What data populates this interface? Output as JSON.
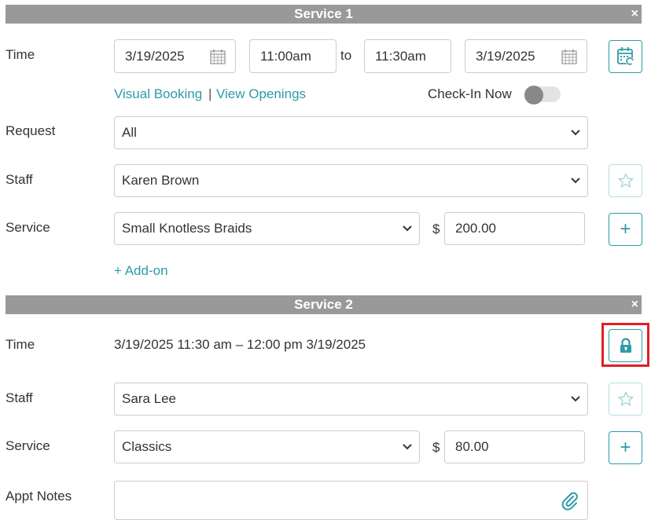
{
  "service1": {
    "header": "Service 1",
    "close_glyph": "×",
    "time_label": "Time",
    "start_date": "3/19/2025",
    "start_time": "11:00am",
    "to_label": "to",
    "end_time": "11:30am",
    "end_date": "3/19/2025",
    "visual_booking": "Visual Booking",
    "link_separator": "|",
    "view_openings": "View Openings",
    "checkin_label": "Check-In Now",
    "checkin_on": false,
    "request_label": "Request",
    "request_value": "All",
    "staff_label": "Staff",
    "staff_value": "Karen Brown",
    "service_label": "Service",
    "service_value": "Small Knotless Braids",
    "currency": "$",
    "price": "200.00",
    "add_on": "+ Add-on",
    "plus_glyph": "+"
  },
  "service2": {
    "header": "Service 2",
    "close_glyph": "×",
    "time_label": "Time",
    "time_summary": "3/19/2025 11:30 am – 12:00 pm 3/19/2025",
    "staff_label": "Staff",
    "staff_value": "Sara Lee",
    "service_label": "Service",
    "service_value": "Classics",
    "currency": "$",
    "price": "80.00",
    "plus_glyph": "+"
  },
  "notes": {
    "label": "Appt Notes",
    "value": ""
  },
  "colors": {
    "accent": "#2e9ba6",
    "header_bar": "#999999",
    "highlight": "#e01f26"
  },
  "icons": [
    "calendar-icon",
    "calendar-refresh-icon",
    "star-icon",
    "plus-icon",
    "lock-icon",
    "paperclip-icon",
    "chevron-down-icon",
    "close-icon"
  ]
}
